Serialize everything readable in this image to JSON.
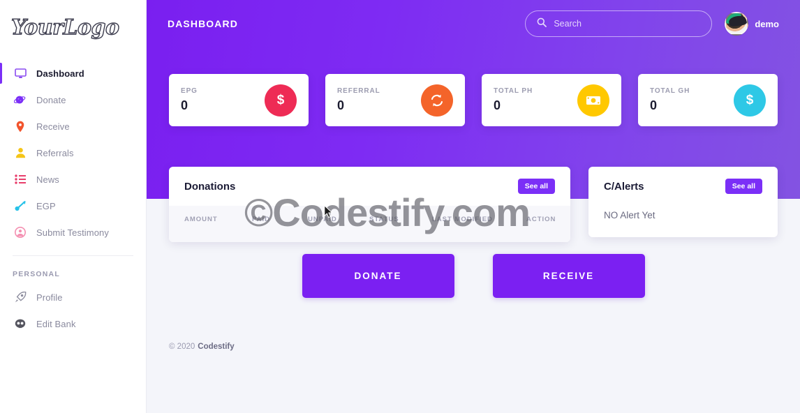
{
  "sidebar": {
    "logo": "YourLogo",
    "items": [
      {
        "label": "Dashboard",
        "icon": "monitor-icon",
        "color": "#8a4bf0",
        "active": true
      },
      {
        "label": "Donate",
        "icon": "planet-icon",
        "color": "#7b2ff7",
        "active": false
      },
      {
        "label": "Receive",
        "icon": "location-pin-icon",
        "color": "#f2542d",
        "active": false
      },
      {
        "label": "Referrals",
        "icon": "user-icon",
        "color": "#f5c518",
        "active": false
      },
      {
        "label": "News",
        "icon": "list-icon",
        "color": "#e83e6b",
        "active": false
      },
      {
        "label": "EGP",
        "icon": "key-icon",
        "color": "#27c2e8",
        "active": false
      },
      {
        "label": "Submit Testimony",
        "icon": "user-circle-icon",
        "color": "#f48fb1",
        "active": false
      }
    ],
    "section_heading": "PERSONAL",
    "personal_items": [
      {
        "label": "Profile",
        "icon": "rocket-icon",
        "color": "#8d8d9e"
      },
      {
        "label": "Edit Bank",
        "icon": "bank-icon",
        "color": "#55555f"
      }
    ]
  },
  "header": {
    "title": "DASHBOARD",
    "search": {
      "value": "",
      "placeholder": "Search",
      "icon": "search-icon"
    },
    "user": {
      "name": "demo",
      "avatar": "user-avatar"
    }
  },
  "stats": [
    {
      "label": "EPG",
      "value": "0",
      "icon": "dollar-icon",
      "color": "#ee2b55"
    },
    {
      "label": "REFERRAL",
      "value": "0",
      "icon": "refresh-icon",
      "color": "#f4642a"
    },
    {
      "label": "TOTAL PH",
      "value": "0",
      "icon": "money-icon",
      "color": "#ffc800"
    },
    {
      "label": "TOTAL GH",
      "value": "0",
      "icon": "dollar-icon",
      "color": "#2ec8e6"
    }
  ],
  "donations_panel": {
    "title": "Donations",
    "see_all_label": "See all",
    "columns": [
      "AMOUNT",
      "PAID",
      "UNPAID",
      "STATUS",
      "LAST MODIFIED",
      "ACTION"
    ],
    "rows": []
  },
  "alerts_panel": {
    "title": "C/Alerts",
    "see_all_label": "See all",
    "empty_text": "NO Alert Yet"
  },
  "actions": {
    "donate_label": "DONATE",
    "receive_label": "RECEIVE"
  },
  "footer": {
    "copyright": "© 2020",
    "brand": "Codestify"
  },
  "watermark": {
    "text": "©Codestify.com"
  },
  "colors": {
    "brand_purple": "#7b2ff7",
    "hero_gradient_start": "#7a1ff0",
    "hero_gradient_end": "#8353e2",
    "page_bg": "#f4f5fa"
  }
}
